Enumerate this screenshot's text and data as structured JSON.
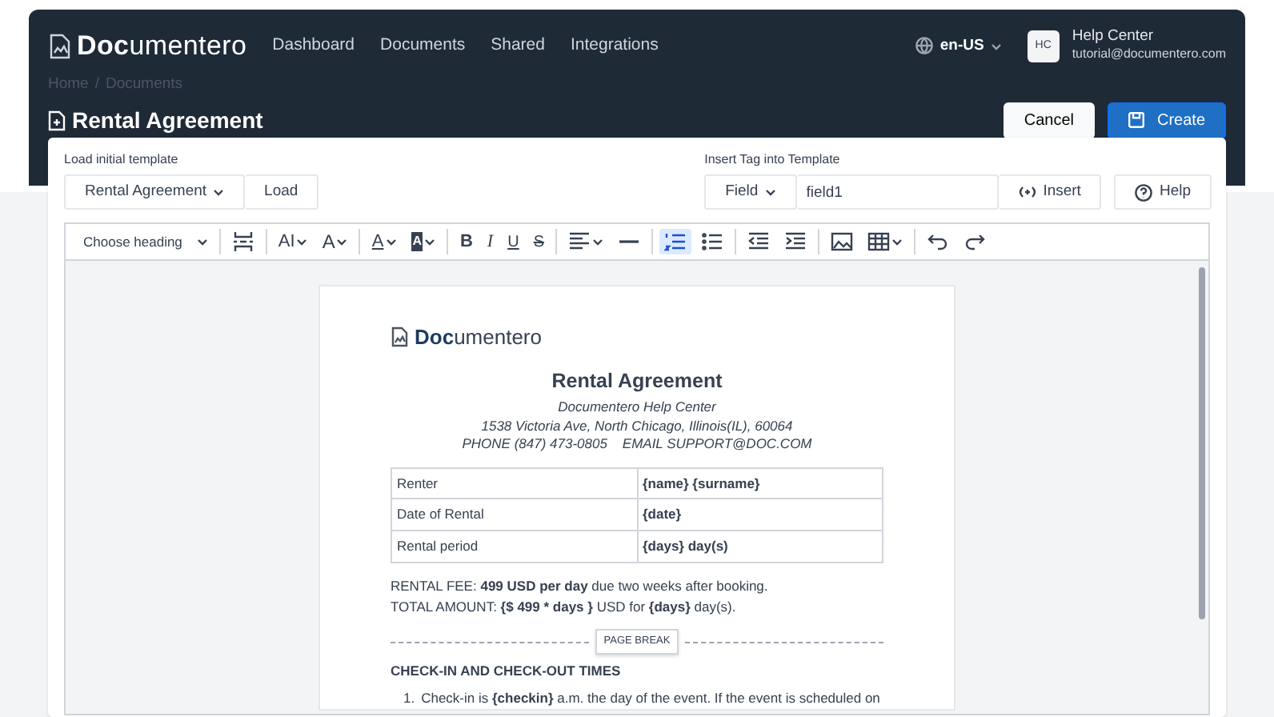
{
  "header": {
    "logo": "**Doc**umentero",
    "nav": [
      {
        "label": "Dashboard"
      },
      {
        "label": "Documents"
      },
      {
        "label": "Shared"
      },
      {
        "label": "Integrations"
      }
    ],
    "language": "en-US",
    "user": {
      "initials": "HC",
      "name": "Help Center",
      "email": "tutorial@documentero.com"
    },
    "breadcrumb": {
      "items": [
        "Home",
        "Documents"
      ],
      "separator": "/"
    },
    "title": "Rental Agreement",
    "buttons": [
      {
        "label": "Cancel",
        "kind": "secondary"
      },
      {
        "label": "Create",
        "kind": "primary"
      }
    ]
  },
  "template": {
    "label": "Load initial template",
    "value": "Rental Agreement",
    "button": "Load"
  },
  "tag": {
    "label": "Insert Tag into Template",
    "type": "Field",
    "value": "field1",
    "button": "Insert",
    "help": "Help"
  },
  "toolbar": [
    [
      {
        "kind": "heading",
        "label": "Choose heading",
        "dropdown": true,
        "active": false
      }
    ],
    [
      {
        "kind": "page-break",
        "dropdown": false,
        "active": false
      }
    ],
    [
      {
        "kind": "font-size",
        "glyph": "AI",
        "dropdown": true,
        "active": false
      },
      {
        "kind": "font-family",
        "glyph": "A",
        "dropdown": true,
        "active": false
      }
    ],
    [
      {
        "kind": "font-color",
        "glyph": "A",
        "dropdown": true,
        "active": false
      },
      {
        "kind": "highlight",
        "glyph": "A",
        "dropdown": true,
        "active": false
      }
    ],
    [
      {
        "kind": "bold",
        "glyph": "B",
        "dropdown": false,
        "active": false
      },
      {
        "kind": "italic",
        "glyph": "I",
        "dropdown": false,
        "active": false
      },
      {
        "kind": "underline",
        "glyph": "U",
        "dropdown": false,
        "active": false
      },
      {
        "kind": "strike",
        "glyph": "S",
        "dropdown": false,
        "active": false
      }
    ],
    [
      {
        "kind": "align",
        "dropdown": true,
        "active": false
      },
      {
        "kind": "rule",
        "dropdown": false,
        "active": false
      }
    ],
    [
      {
        "kind": "numbered-list",
        "dropdown": false,
        "active": true
      },
      {
        "kind": "bulleted-list",
        "dropdown": false,
        "active": false
      }
    ],
    [
      {
        "kind": "outdent",
        "dropdown": false,
        "active": false
      },
      {
        "kind": "indent",
        "dropdown": false,
        "active": false
      }
    ],
    [
      {
        "kind": "image",
        "dropdown": false,
        "active": false
      },
      {
        "kind": "table",
        "dropdown": true,
        "active": false
      }
    ],
    [
      {
        "kind": "undo",
        "dropdown": false,
        "active": false
      },
      {
        "kind": "redo",
        "dropdown": false,
        "active": false
      }
    ]
  ],
  "document": {
    "logo": "**Doc**umentero",
    "title": "Rental Agreement",
    "address_lines": [
      "Documentero Help Center",
      "1538 Victoria Ave, North Chicago, Illinois(IL), 60064",
      "PHONE (847) 473-0805    EMAIL SUPPORT@DOC.COM"
    ],
    "table": [
      {
        "label": "Renter",
        "value": "{name} {surname}"
      },
      {
        "label": "Date of Rental",
        "value": "{date}"
      },
      {
        "label": "Rental period",
        "value": "{days} day(s)"
      }
    ],
    "fee_lines": [
      "RENTAL FEE: **499 USD per day** due two weeks after booking.",
      "TOTAL AMOUNT: **{$ 499 * days }** USD for **{days}** day(s)."
    ],
    "page_break": "PAGE BREAK",
    "section_heading": "CHECK-IN AND CHECK-OUT TIMES",
    "list": [
      {
        "number": "1.",
        "text": "Check-in is **{checkin}** a.m. the day of the event. If the event is scheduled on"
      }
    ]
  }
}
